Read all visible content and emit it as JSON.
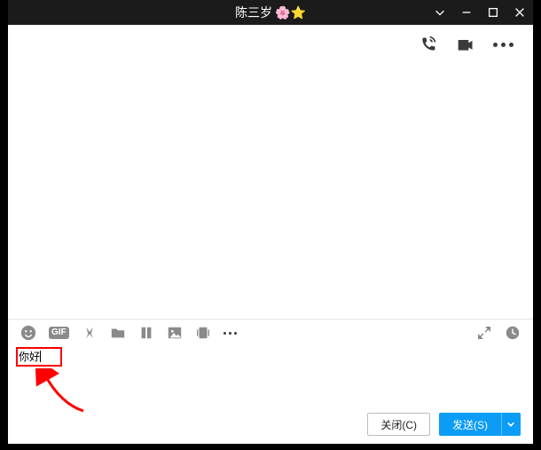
{
  "title": "陈三岁",
  "title_emojis": "🌸⭐",
  "input_value": "你好",
  "footer": {
    "close_label": "关闭(C)",
    "send_label": "发送(S)"
  },
  "toolbar": {
    "gif_label": "GIF"
  }
}
